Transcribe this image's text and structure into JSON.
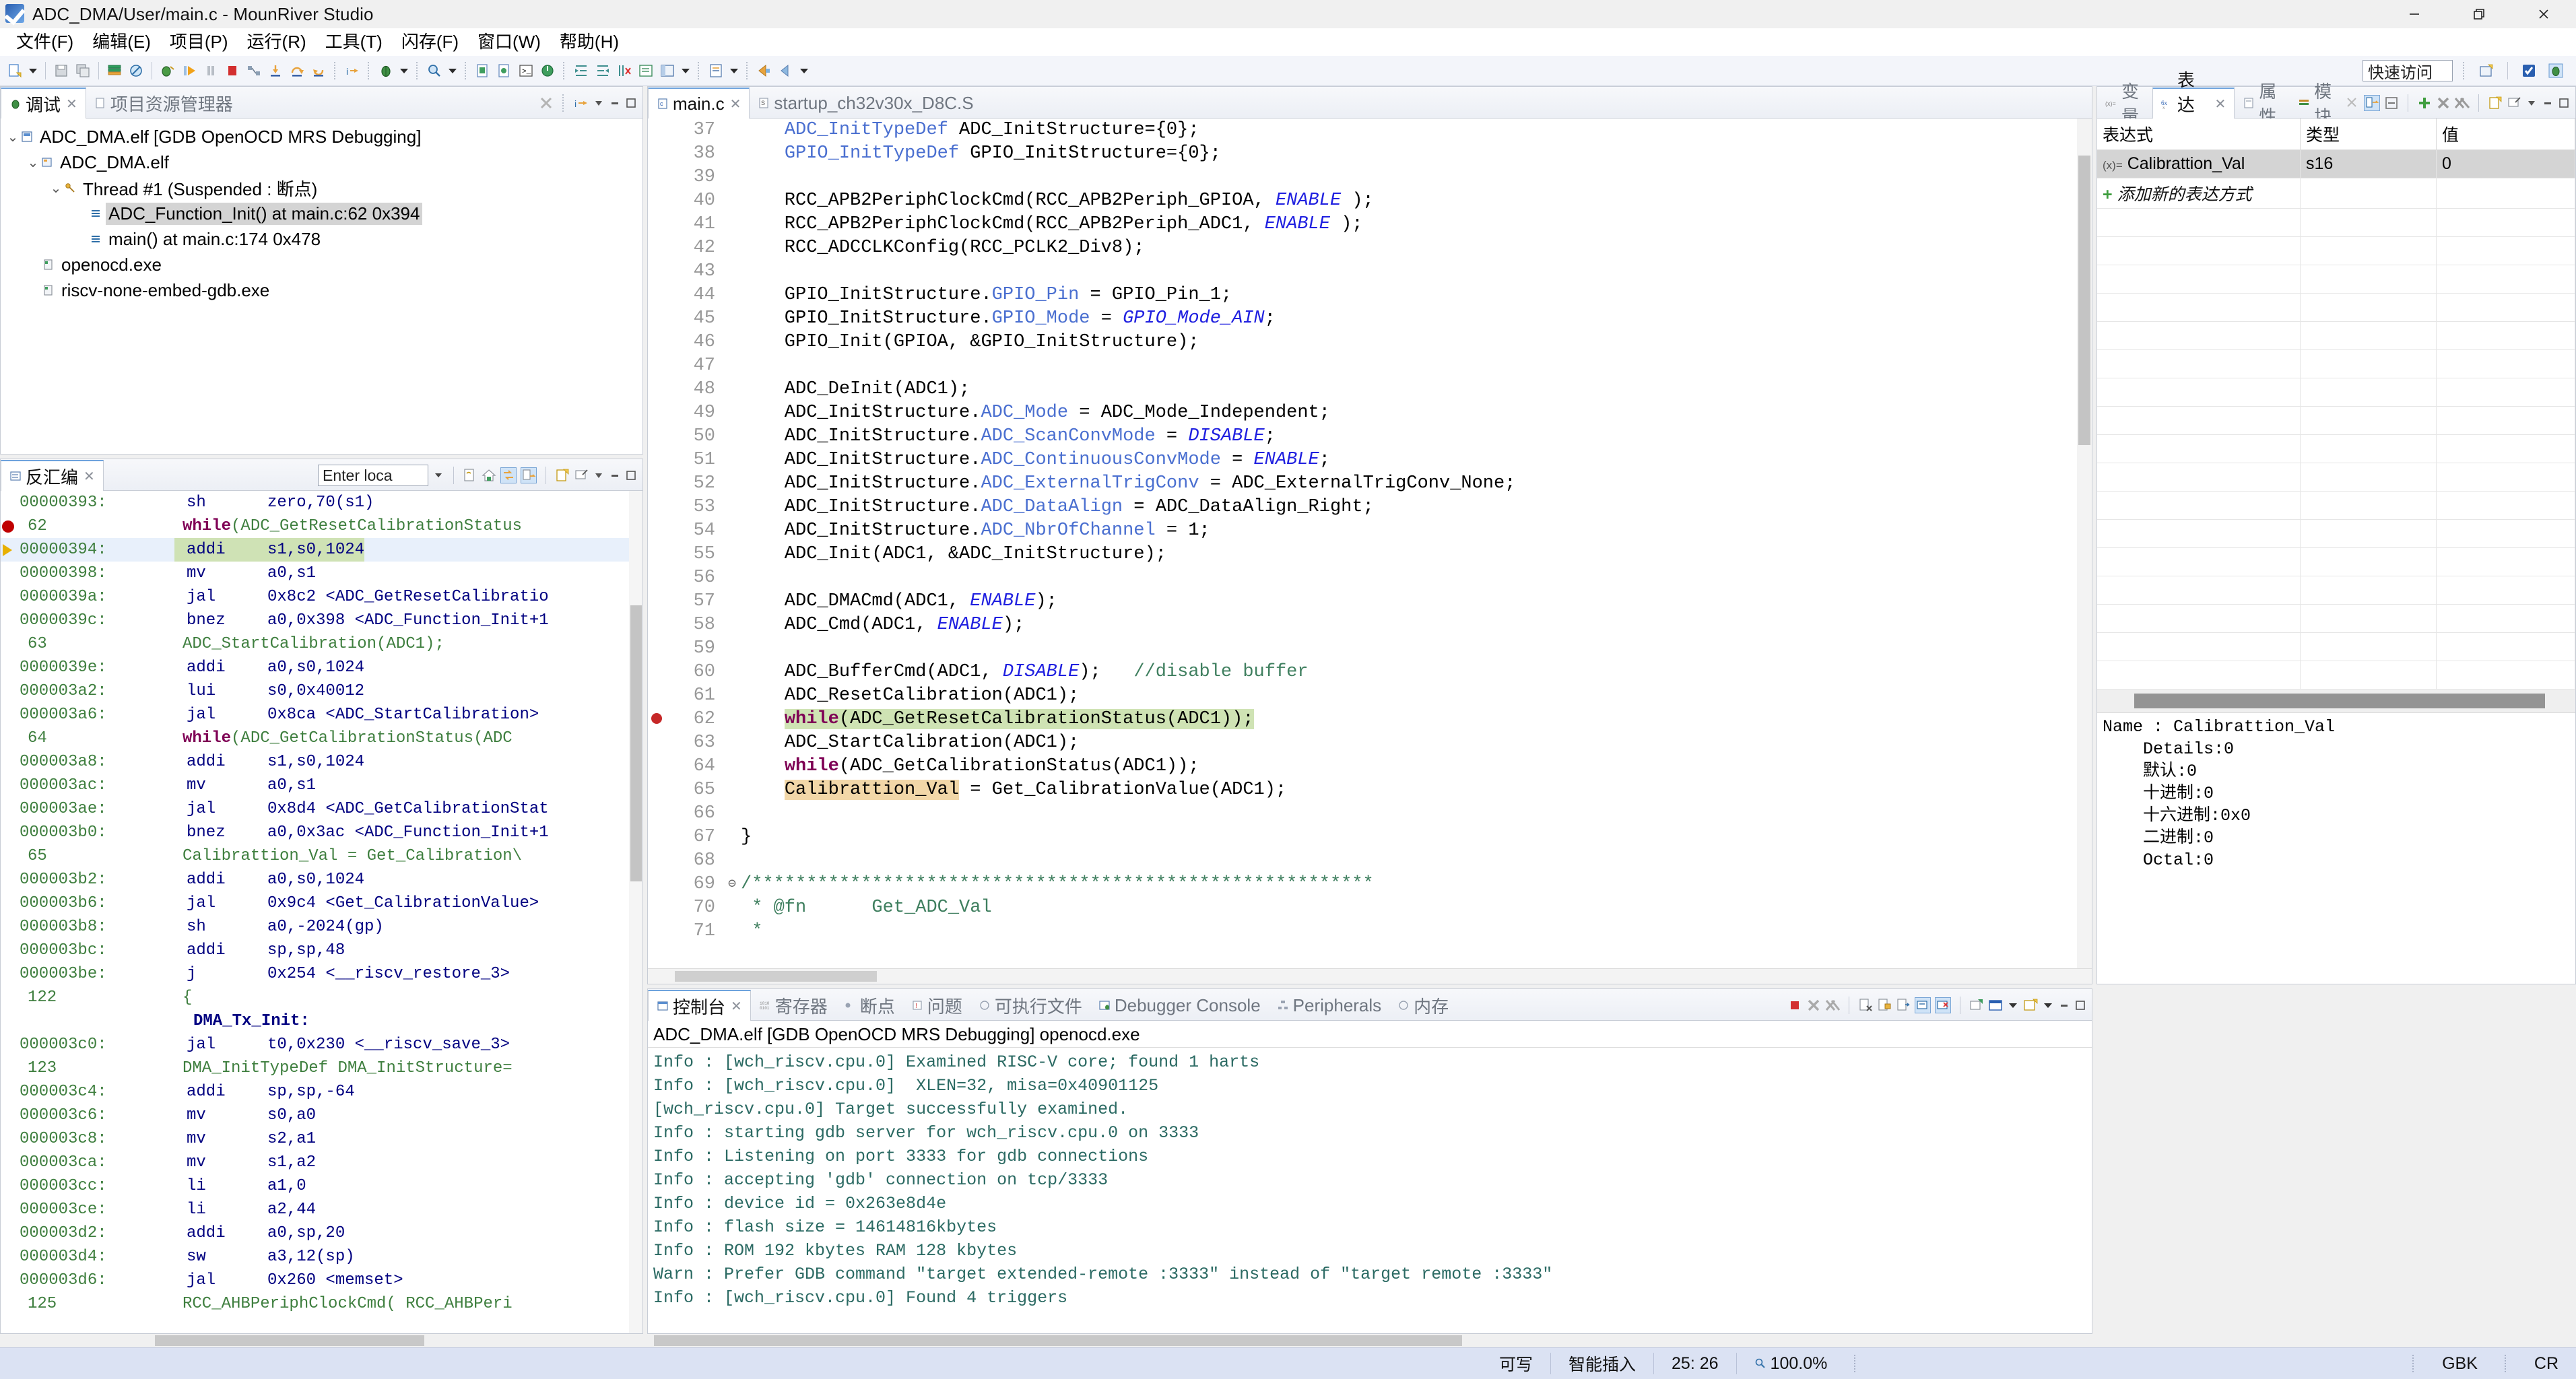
{
  "window": {
    "title": "ADC_DMA/User/main.c - MounRiver Studio",
    "app_icon": "mounriver-logo-icon",
    "minimize": "minimize-icon",
    "restore": "restore-icon",
    "close": "close-icon"
  },
  "menubar": {
    "items": [
      {
        "label": "文件(F)",
        "name": "menu-file"
      },
      {
        "label": "编辑(E)",
        "name": "menu-edit"
      },
      {
        "label": "项目(P)",
        "name": "menu-project"
      },
      {
        "label": "运行(R)",
        "name": "menu-run"
      },
      {
        "label": "工具(T)",
        "name": "menu-tools"
      },
      {
        "label": "闪存(F)",
        "name": "menu-flash"
      },
      {
        "label": "窗口(W)",
        "name": "menu-window"
      },
      {
        "label": "帮助(H)",
        "name": "menu-help"
      }
    ]
  },
  "toolbar": {
    "quick_access": "快速访问"
  },
  "debug_view": {
    "tabs": [
      {
        "label": "调试",
        "active": true,
        "closable": true
      },
      {
        "label": "项目资源管理器",
        "active": false,
        "closable": false
      }
    ],
    "tree": [
      {
        "label": "ADC_DMA.elf [GDB OpenOCD MRS Debugging]",
        "depth": 0,
        "arrow": "⌄",
        "icon": "launch-config-icon",
        "selected": false
      },
      {
        "label": "ADC_DMA.elf",
        "depth": 1,
        "arrow": "⌄",
        "icon": "process-icon",
        "selected": false
      },
      {
        "label": "Thread #1 (Suspended : 断点)",
        "depth": 2,
        "arrow": "⌄",
        "icon": "thread-icon",
        "selected": false
      },
      {
        "label": "ADC_Function_Init() at main.c:62 0x394",
        "depth": 3,
        "arrow": "",
        "icon": "stackframe-icon",
        "selected": true
      },
      {
        "label": "main() at main.c:174 0x478",
        "depth": 3,
        "arrow": "",
        "icon": "stackframe-icon",
        "selected": false
      },
      {
        "label": "openocd.exe",
        "depth": 1,
        "arrow": "",
        "icon": "exe-icon",
        "selected": false
      },
      {
        "label": "riscv-none-embed-gdb.exe",
        "depth": 1,
        "arrow": "",
        "icon": "exe-icon",
        "selected": false
      }
    ]
  },
  "disassembly_view": {
    "tabs": [
      {
        "label": "反汇编",
        "active": true,
        "closable": true
      }
    ],
    "location_input_value": "Enter loca",
    "rows": [
      {
        "kind": "inst",
        "addr": "00000393:",
        "mnemonic": "sh",
        "operands": "zero,70(s1)",
        "mark": ""
      },
      {
        "kind": "src",
        "line": "62",
        "text": "while(ADC_GetResetCalibrationStatus",
        "keyword": "while",
        "mark": "breakpoint"
      },
      {
        "kind": "inst",
        "addr": "00000394:",
        "mnemonic": "addi",
        "operands": "s1,s0,1024",
        "mark": "ip",
        "current": true
      },
      {
        "kind": "inst",
        "addr": "00000398:",
        "mnemonic": "mv",
        "operands": "a0,s1",
        "mark": ""
      },
      {
        "kind": "inst",
        "addr": "0000039a:",
        "mnemonic": "jal",
        "operands": "0x8c2 <ADC_GetResetCalibratio",
        "mark": ""
      },
      {
        "kind": "inst",
        "addr": "0000039c:",
        "mnemonic": "bnez",
        "operands": "a0,0x398 <ADC_Function_Init+1",
        "mark": ""
      },
      {
        "kind": "src",
        "line": "63",
        "text": "ADC_StartCalibration(ADC1);",
        "keyword": "",
        "mark": ""
      },
      {
        "kind": "inst",
        "addr": "0000039e:",
        "mnemonic": "addi",
        "operands": "a0,s0,1024",
        "mark": ""
      },
      {
        "kind": "inst",
        "addr": "000003a2:",
        "mnemonic": "lui",
        "operands": "s0,0x40012",
        "mark": ""
      },
      {
        "kind": "inst",
        "addr": "000003a6:",
        "mnemonic": "jal",
        "operands": "0x8ca <ADC_StartCalibration>",
        "mark": ""
      },
      {
        "kind": "src",
        "line": "64",
        "text": "while(ADC_GetCalibrationStatus(ADC",
        "keyword": "while",
        "mark": ""
      },
      {
        "kind": "inst",
        "addr": "000003a8:",
        "mnemonic": "addi",
        "operands": "s1,s0,1024",
        "mark": ""
      },
      {
        "kind": "inst",
        "addr": "000003ac:",
        "mnemonic": "mv",
        "operands": "a0,s1",
        "mark": ""
      },
      {
        "kind": "inst",
        "addr": "000003ae:",
        "mnemonic": "jal",
        "operands": "0x8d4 <ADC_GetCalibrationStat",
        "mark": ""
      },
      {
        "kind": "inst",
        "addr": "000003b0:",
        "mnemonic": "bnez",
        "operands": "a0,0x3ac <ADC_Function_Init+1",
        "mark": ""
      },
      {
        "kind": "src",
        "line": "65",
        "text": "Calibrattion_Val = Get_Calibration\\",
        "keyword": "",
        "mark": ""
      },
      {
        "kind": "inst",
        "addr": "000003b2:",
        "mnemonic": "addi",
        "operands": "a0,s0,1024",
        "mark": ""
      },
      {
        "kind": "inst",
        "addr": "000003b6:",
        "mnemonic": "jal",
        "operands": "0x9c4 <Get_CalibrationValue>",
        "mark": ""
      },
      {
        "kind": "inst",
        "addr": "000003b8:",
        "mnemonic": "sh",
        "operands": "a0,-2024(gp)",
        "mark": ""
      },
      {
        "kind": "inst",
        "addr": "000003bc:",
        "mnemonic": "addi",
        "operands": "sp,sp,48",
        "mark": ""
      },
      {
        "kind": "inst",
        "addr": "000003be:",
        "mnemonic": "j",
        "operands": "0x254 <__riscv_restore_3>",
        "mark": ""
      },
      {
        "kind": "src",
        "line": "122",
        "text": "{",
        "keyword": "",
        "mark": ""
      },
      {
        "kind": "label",
        "text": "DMA_Tx_Init:"
      },
      {
        "kind": "inst",
        "addr": "000003c0:",
        "mnemonic": "jal",
        "operands": "t0,0x230 <__riscv_save_3>",
        "mark": ""
      },
      {
        "kind": "src",
        "line": "123",
        "text": "DMA_InitTypeDef DMA_InitStructure=",
        "keyword": "",
        "mark": ""
      },
      {
        "kind": "inst",
        "addr": "000003c4:",
        "mnemonic": "addi",
        "operands": "sp,sp,-64",
        "mark": ""
      },
      {
        "kind": "inst",
        "addr": "000003c6:",
        "mnemonic": "mv",
        "operands": "s0,a0",
        "mark": ""
      },
      {
        "kind": "inst",
        "addr": "000003c8:",
        "mnemonic": "mv",
        "operands": "s2,a1",
        "mark": ""
      },
      {
        "kind": "inst",
        "addr": "000003ca:",
        "mnemonic": "mv",
        "operands": "s1,a2",
        "mark": ""
      },
      {
        "kind": "inst",
        "addr": "000003cc:",
        "mnemonic": "li",
        "operands": "a1,0",
        "mark": ""
      },
      {
        "kind": "inst",
        "addr": "000003ce:",
        "mnemonic": "li",
        "operands": "a2,44",
        "mark": ""
      },
      {
        "kind": "inst",
        "addr": "000003d2:",
        "mnemonic": "addi",
        "operands": "a0,sp,20",
        "mark": ""
      },
      {
        "kind": "inst",
        "addr": "000003d4:",
        "mnemonic": "sw",
        "operands": "a3,12(sp)",
        "mark": ""
      },
      {
        "kind": "inst",
        "addr": "000003d6:",
        "mnemonic": "jal",
        "operands": "0x260 <memset>",
        "mark": ""
      },
      {
        "kind": "src",
        "line": "125",
        "text": "RCC_AHBPeriphClockCmd( RCC_AHBPeri",
        "keyword": "",
        "mark": ""
      }
    ]
  },
  "editor": {
    "tabs": [
      {
        "label": "main.c",
        "active": true,
        "closable": true,
        "icon": "c-file-icon"
      },
      {
        "label": "startup_ch32v30x_D8C.S",
        "active": false,
        "closable": false,
        "icon": "asm-file-icon"
      }
    ],
    "first_line": 37,
    "lines": [
      {
        "n": 37,
        "html": "    <span class=\"fld\">ADC_InitTypeDef</span> ADC_InitStructure={0};"
      },
      {
        "n": 38,
        "html": "    <span class=\"fld\">GPIO_InitTypeDef</span> GPIO_InitStructure={0};"
      },
      {
        "n": 39,
        "html": ""
      },
      {
        "n": 40,
        "html": "    RCC_APB2PeriphClockCmd(RCC_APB2Periph_GPIOA, <span class=\"mac\">ENABLE</span> );"
      },
      {
        "n": 41,
        "html": "    RCC_APB2PeriphClockCmd(RCC_APB2Periph_ADC1, <span class=\"mac\">ENABLE</span> );"
      },
      {
        "n": 42,
        "html": "    RCC_ADCCLKConfig(RCC_PCLK2_Div8);"
      },
      {
        "n": 43,
        "html": ""
      },
      {
        "n": 44,
        "html": "    GPIO_InitStructure.<span class=\"fld\">GPIO_Pin</span> = GPIO_Pin_1;"
      },
      {
        "n": 45,
        "html": "    GPIO_InitStructure.<span class=\"fld\">GPIO_Mode</span> = <span class=\"mac\">GPIO_Mode_AIN</span>;"
      },
      {
        "n": 46,
        "html": "    GPIO_Init(GPIOA, &amp;GPIO_InitStructure);"
      },
      {
        "n": 47,
        "html": ""
      },
      {
        "n": 48,
        "html": "    ADC_DeInit(ADC1);"
      },
      {
        "n": 49,
        "html": "    ADC_InitStructure.<span class=\"fld\">ADC_Mode</span> = ADC_Mode_Independent;"
      },
      {
        "n": 50,
        "html": "    ADC_InitStructure.<span class=\"fld\">ADC_ScanConvMode</span> = <span class=\"mac\">DISABLE</span>;"
      },
      {
        "n": 51,
        "html": "    ADC_InitStructure.<span class=\"fld\">ADC_ContinuousConvMode</span> = <span class=\"mac\">ENABLE</span>;"
      },
      {
        "n": 52,
        "html": "    ADC_InitStructure.<span class=\"fld\">ADC_ExternalTrigConv</span> = ADC_ExternalTrigConv_None;"
      },
      {
        "n": 53,
        "html": "    ADC_InitStructure.<span class=\"fld\">ADC_DataAlign</span> = ADC_DataAlign_Right;"
      },
      {
        "n": 54,
        "html": "    ADC_InitStructure.<span class=\"fld\">ADC_NbrOfChannel</span> = 1;"
      },
      {
        "n": 55,
        "html": "    ADC_Init(ADC1, &amp;ADC_InitStructure);"
      },
      {
        "n": 56,
        "html": ""
      },
      {
        "n": 57,
        "html": "    ADC_DMACmd(ADC1, <span class=\"mac\">ENABLE</span>);"
      },
      {
        "n": 58,
        "html": "    ADC_Cmd(ADC1, <span class=\"mac\">ENABLE</span>);"
      },
      {
        "n": 59,
        "html": ""
      },
      {
        "n": 60,
        "html": "    ADC_BufferCmd(ADC1, <span class=\"mac\">DISABLE</span>);   <span class=\"cmt\">//disable buffer</span>"
      },
      {
        "n": 61,
        "html": "    ADC_ResetCalibration(ADC1);"
      },
      {
        "n": 62,
        "html": "    <span class=\"hl-exec\"><span class=\"kw\">while</span>(ADC_GetResetCalibrationStatus(ADC1));</span>",
        "exec": true,
        "breakpoint": true
      },
      {
        "n": 63,
        "html": "    ADC_StartCalibration(ADC1);"
      },
      {
        "n": 64,
        "html": "    <span class=\"kw\">while</span>(ADC_GetCalibrationStatus(ADC1));"
      },
      {
        "n": 65,
        "html": "    <span class=\"hl-occ\">Calibrattion_Val</span> = Get_CalibrationValue(ADC1);"
      },
      {
        "n": 66,
        "html": ""
      },
      {
        "n": 67,
        "html": "}"
      },
      {
        "n": 68,
        "html": ""
      },
      {
        "n": 69,
        "html": "<span class=\"cmt\">/*********************************************************</span>",
        "fold": true
      },
      {
        "n": 70,
        "html": " <span class=\"cmt\">* @fn      Get_ADC_Val</span>"
      },
      {
        "n": 71,
        "html": " <span class=\"cmt\">*</span>"
      }
    ]
  },
  "expressions_view": {
    "tabs": [
      {
        "label": "变量",
        "active": false
      },
      {
        "label": "表达式",
        "active": true,
        "closable": true
      },
      {
        "label": "属性",
        "active": false
      },
      {
        "label": "模块",
        "active": false
      }
    ],
    "columns": [
      "表达式",
      "类型",
      "值"
    ],
    "rows": [
      {
        "expression": "Calibrattion_Val",
        "type": "s16",
        "value": "0",
        "selected": true,
        "icon": "variable-icon"
      }
    ],
    "add_new_label": "添加新的表达方式",
    "detail": "Name : Calibrattion_Val\n    Details:0\n    默认:0\n    十进制:0\n    十六进制:0x0\n    二进制:0\n    Octal:0"
  },
  "console_view": {
    "tabs": [
      {
        "label": "控制台",
        "active": true,
        "closable": true
      },
      {
        "label": "寄存器",
        "active": false
      },
      {
        "label": "断点",
        "active": false
      },
      {
        "label": "问题",
        "active": false
      },
      {
        "label": "可执行文件",
        "active": false
      },
      {
        "label": "Debugger Console",
        "active": false
      },
      {
        "label": "Peripherals",
        "active": false
      },
      {
        "label": "内存",
        "active": false
      }
    ],
    "header": "ADC_DMA.elf [GDB OpenOCD MRS Debugging] openocd.exe",
    "lines": [
      "Info : [wch_riscv.cpu.0] Examined RISC-V core; found 1 harts",
      "Info : [wch_riscv.cpu.0]  XLEN=32, misa=0x40901125",
      "[wch_riscv.cpu.0] Target successfully examined.",
      "Info : starting gdb server for wch_riscv.cpu.0 on 3333",
      "Info : Listening on port 3333 for gdb connections",
      "Info : accepting 'gdb' connection on tcp/3333",
      "Info : device id = 0x263e8d4e",
      "Info : flash size = 14614816kbytes",
      "Info : ROM 192 kbytes RAM 128 kbytes",
      "Warn : Prefer GDB command \"target extended-remote :3333\" instead of \"target remote :3333\"",
      "Info : [wch_riscv.cpu.0] Found 4 triggers"
    ]
  },
  "statusbar": {
    "writable": "可写",
    "insert_mode": "智能插入",
    "position": "25: 26",
    "zoom": "100.0%",
    "zoom_icon": "magnifier-icon",
    "right_1": "GBK",
    "right_2": "CR"
  }
}
